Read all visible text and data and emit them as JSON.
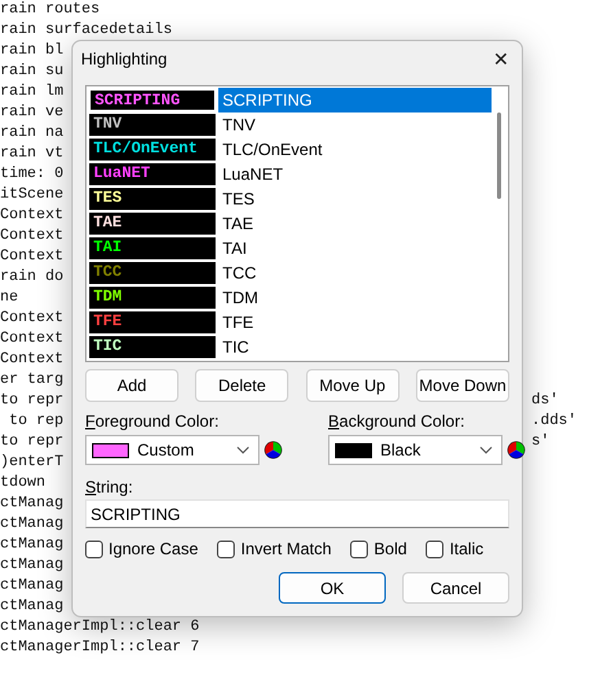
{
  "log_lines": [
    {
      "left": "rain routes"
    },
    {
      "left": "rain surfacedetails"
    },
    {
      "left": "rain bl"
    },
    {
      "left": "rain su"
    },
    {
      "left": "rain lm"
    },
    {
      "left": "rain ve"
    },
    {
      "left": "rain na"
    },
    {
      "left": "rain vt"
    },
    {
      "left": "time: 0"
    },
    {
      "left": "itScene"
    },
    {
      "left": "Context"
    },
    {
      "left": "Context"
    },
    {
      "left": "Context"
    },
    {
      "left": "rain do"
    },
    {
      "left": "ne"
    },
    {
      "left": "Context"
    },
    {
      "left": "Context"
    },
    {
      "left": "Context"
    },
    {
      "left": "er targ"
    },
    {
      "left": "to repr",
      "right": "ds'"
    },
    {
      "left": " to rep",
      "right": ".dds'"
    },
    {
      "left": "to repr",
      "right": "s'"
    },
    {
      "left": ")enterT"
    },
    {
      "left": "tdown"
    },
    {
      "left": "ctManag"
    },
    {
      "left": "ctManag"
    },
    {
      "left": "ctManag"
    },
    {
      "left": "ctManag"
    },
    {
      "left": "ctManag"
    },
    {
      "left": "ctManag"
    },
    {
      "left": "ctManagerImpl::clear 6"
    },
    {
      "left": "ctManagerImpl::clear 7"
    }
  ],
  "dialog": {
    "title": "Highlighting",
    "close": "✕",
    "rules": [
      {
        "sample": "SCRIPTING",
        "label": "SCRIPTING",
        "color": "#ff55ff",
        "selected": true
      },
      {
        "sample": "TNV",
        "label": "TNV",
        "color": "#c0c0c0",
        "selected": false
      },
      {
        "sample": "TLC/OnEvent",
        "label": "TLC/OnEvent",
        "color": "#00e0e0",
        "selected": false
      },
      {
        "sample": "LuaNET",
        "label": "LuaNET",
        "color": "#ff40ff",
        "selected": false
      },
      {
        "sample": "TES",
        "label": "TES",
        "color": "#ffff99",
        "selected": false
      },
      {
        "sample": "TAE",
        "label": "TAE",
        "color": "#ffe0e0",
        "selected": false
      },
      {
        "sample": "TAI",
        "label": "TAI",
        "color": "#00ff00",
        "selected": false
      },
      {
        "sample": "TCC",
        "label": "TCC",
        "color": "#808000",
        "selected": false
      },
      {
        "sample": "TDM",
        "label": "TDM",
        "color": "#80ff00",
        "selected": false
      },
      {
        "sample": "TFE",
        "label": "TFE",
        "color": "#ff4040",
        "selected": false
      },
      {
        "sample": "TIC",
        "label": "TIC",
        "color": "#c0ffc0",
        "selected": false
      }
    ],
    "list_buttons": [
      "Add",
      "Delete",
      "Move Up",
      "Move Down"
    ],
    "foreground": {
      "label": "Foreground Color:",
      "value": "Custom",
      "color": "#ff66ff"
    },
    "background": {
      "label": "Background Color:",
      "value": "Black",
      "color": "#000000"
    },
    "string": {
      "label": "String:",
      "value": "SCRIPTING"
    },
    "options": [
      {
        "label": "Ignore Case",
        "checked": false
      },
      {
        "label": "Invert Match",
        "checked": false
      },
      {
        "label": "Bold",
        "checked": false
      },
      {
        "label": "Italic",
        "checked": false
      }
    ],
    "buttons": [
      {
        "label": "OK",
        "kind": "default"
      },
      {
        "label": "Cancel",
        "kind": "normal"
      }
    ]
  }
}
